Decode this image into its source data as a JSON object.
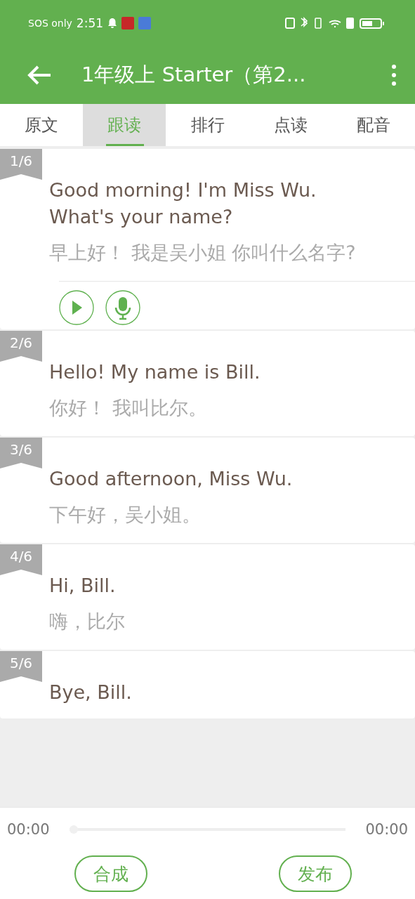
{
  "status_bar": {
    "carrier": "SOS only",
    "time": "2:51"
  },
  "app_bar": {
    "title": "1年级上 Starter（第2..."
  },
  "tabs": [
    {
      "label": "原文",
      "selected": false
    },
    {
      "label": "跟读",
      "selected": true
    },
    {
      "label": "排行",
      "selected": false
    },
    {
      "label": "点读",
      "selected": false
    },
    {
      "label": "配音",
      "selected": false
    }
  ],
  "sentences": [
    {
      "index": "1/6",
      "english": "Good morning! I'm Miss Wu. What's your name?",
      "chinese": "早上好！ 我是吴小姐 你叫什么名字?",
      "expanded": true
    },
    {
      "index": "2/6",
      "english": "Hello! My name is Bill.",
      "chinese": "你好！ 我叫比尔。",
      "expanded": false
    },
    {
      "index": "3/6",
      "english": "Good afternoon, Miss Wu.",
      "chinese": "下午好，吴小姐。",
      "expanded": false
    },
    {
      "index": "4/6",
      "english": "Hi, Bill.",
      "chinese": "嗨，比尔",
      "expanded": false
    },
    {
      "index": "5/6",
      "english": "Bye, Bill.",
      "expanded": false
    }
  ],
  "player": {
    "elapsed": "00:00",
    "total": "00:00",
    "level": 0
  },
  "buttons": [
    "合成",
    "发布"
  ]
}
